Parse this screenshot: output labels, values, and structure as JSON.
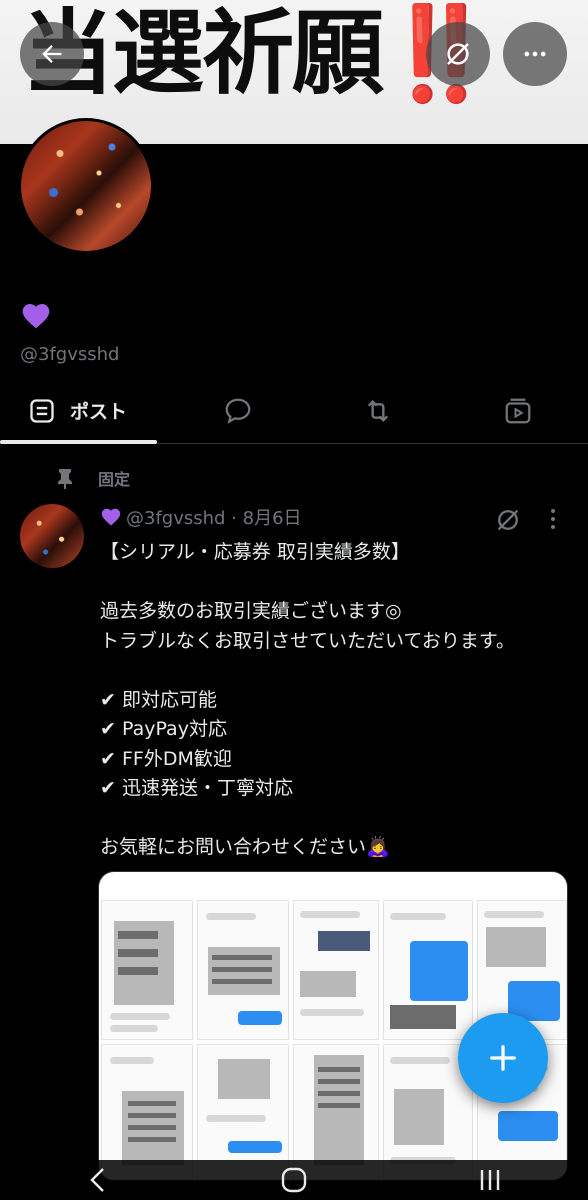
{
  "banner": {
    "text": "当選祈願",
    "exclaim": "‼️",
    "accent": "#e8251d"
  },
  "header": {
    "back_icon": "arrow-left-icon",
    "grok_icon": "grok-icon",
    "more_icon": "more-horizontal-icon"
  },
  "profile": {
    "display_name_emoji": "💜",
    "handle": "@3fgvsshd"
  },
  "tabs": [
    {
      "label": "ポスト",
      "icon": "posts-icon",
      "active": true
    },
    {
      "label": "",
      "icon": "reply-icon",
      "active": false
    },
    {
      "label": "",
      "icon": "repost-icon",
      "active": false
    },
    {
      "label": "",
      "icon": "media-icon",
      "active": false
    }
  ],
  "pinned_label": "固定",
  "post": {
    "handle_date": "@3fgvsshd · 8月6日",
    "body": "【シリアル・応募券 取引実績多数】\n\n過去多数のお取引実績ございます◎\nトラブルなくお取引させていただいております。\n\n✔ 即対応可能\n✔ PayPay対応\n✔ FF外DM歓迎\n✔ 迅速発送・丁寧対応\n\nお気軽にお問い合わせください🙇‍♀️"
  },
  "colors": {
    "background": "#000000",
    "text_primary": "#e7e9ea",
    "text_secondary": "#71767b",
    "accent_blue": "#1d9bf0",
    "divider": "#2f3336"
  },
  "fab_icon": "plus-icon",
  "system_nav": {
    "back_icon": "nav-back-icon",
    "home_icon": "nav-home-icon",
    "recents_icon": "nav-recents-icon"
  }
}
